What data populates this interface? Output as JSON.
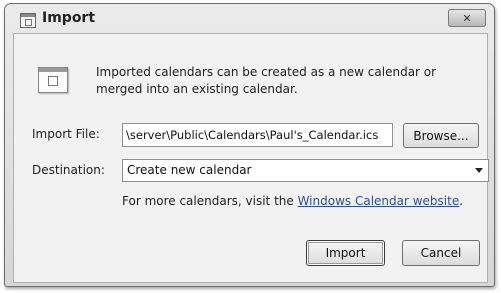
{
  "window": {
    "title": "Import",
    "close_label": "✕"
  },
  "info": {
    "text": "Imported calendars can be created as a new calendar or merged into an existing calendar."
  },
  "import_file": {
    "label": "Import File:",
    "value": "\\server\\Public\\Calendars\\Paul's_Calendar.ics",
    "browse_label": "Browse..."
  },
  "destination": {
    "label": "Destination:",
    "selected": "Create new calendar"
  },
  "more": {
    "prefix": "For more calendars, visit the ",
    "link": "Windows Calendar website",
    "suffix": "."
  },
  "buttons": {
    "import": "Import",
    "cancel": "Cancel"
  },
  "icons": {
    "title": "calendar-import-icon",
    "info": "calendar-import-icon",
    "close": "close-icon",
    "dropdown": "chevron-down-icon"
  }
}
